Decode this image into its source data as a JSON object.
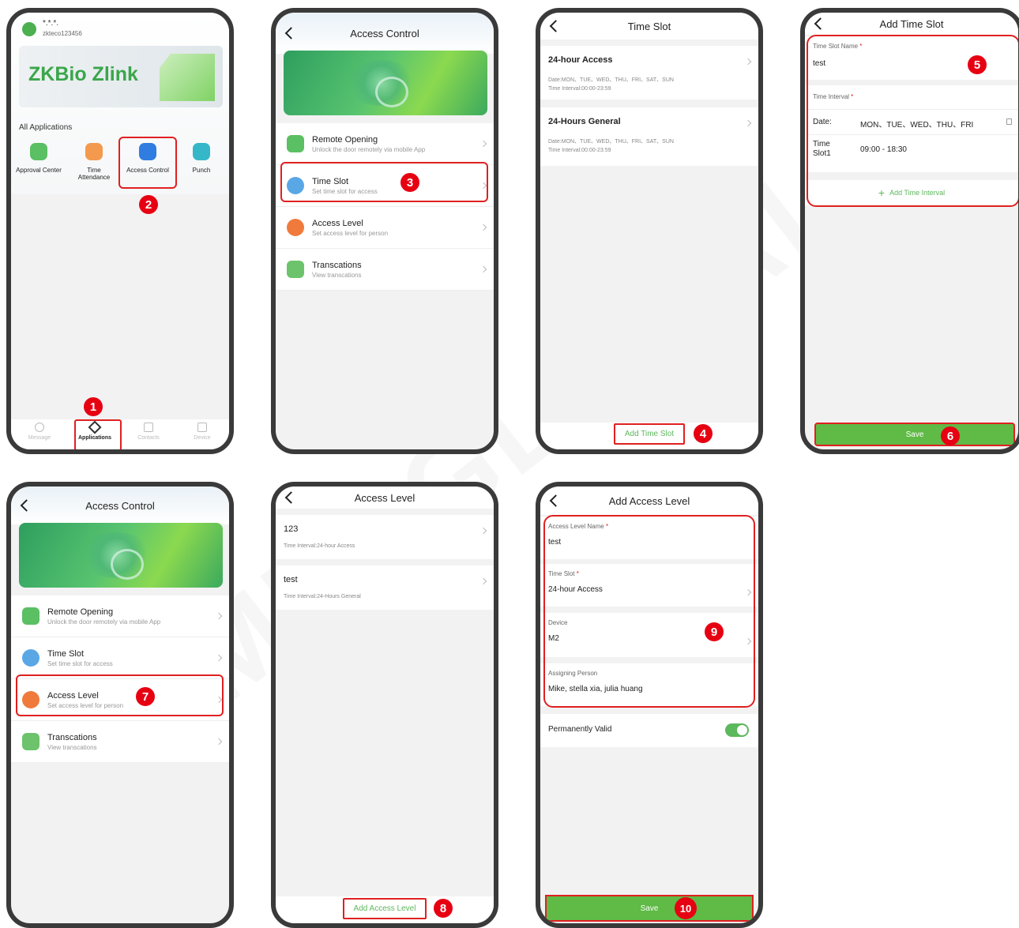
{
  "colors": {
    "accent": "#5fba46",
    "badge": "#e60012",
    "highlight": "#e02020"
  },
  "steps": [
    "1",
    "2",
    "3",
    "4",
    "5",
    "6",
    "7",
    "8",
    "9",
    "10"
  ],
  "watermark": "TEMID-GLOBAL",
  "s1": {
    "masked_name": "*.*.*.",
    "username": "zkteco123456",
    "banner_text": "ZKBio Zlink",
    "section": "All Applications",
    "apps": [
      {
        "label": "Approval Center",
        "icon": "approval-icon"
      },
      {
        "label": "Time Attendance",
        "icon": "time-attendance-icon"
      },
      {
        "label": "Access Control",
        "icon": "access-control-icon"
      },
      {
        "label": "Punch",
        "icon": "punch-icon"
      }
    ],
    "tabs": [
      {
        "label": "Message",
        "icon": "message-icon"
      },
      {
        "label": "Applications",
        "icon": "applications-icon"
      },
      {
        "label": "Contacts",
        "icon": "contacts-icon"
      },
      {
        "label": "Device",
        "icon": "device-icon"
      }
    ]
  },
  "ac": {
    "title": "Access Control",
    "items": [
      {
        "title": "Remote Opening",
        "sub": "Unlock the door remotely via mobile App"
      },
      {
        "title": "Time Slot",
        "sub": "Set time slot for access"
      },
      {
        "title": "Access Level",
        "sub": "Set access level for person"
      },
      {
        "title": "Transcations",
        "sub": "View transcations"
      }
    ]
  },
  "ts": {
    "title": "Time Slot",
    "items": [
      {
        "name": "24-hour Access",
        "date": "Date:MON、TUE、WED、THU、FRI、SAT、SUN",
        "interval": "Time Interval:00:00-23:59"
      },
      {
        "name": "24-Hours General",
        "date": "Date:MON、TUE、WED、THU、FRI、SAT、SUN",
        "interval": "Time Interval:00:00-23:59"
      }
    ],
    "add_button": "Add Time Slot"
  },
  "ats": {
    "title": "Add Time Slot",
    "name_label": "Time Slot Name",
    "name_value": "test",
    "interval_label": "Time Interval",
    "date_label": "Date:",
    "date_value": "MON、TUE、WED、THU、FRI",
    "slot_label_1": "Time",
    "slot_label_2": "Slot1",
    "slot_value": "09:00 - 18:30",
    "add_interval": "Add Time Interval",
    "save": "Save"
  },
  "al": {
    "title": "Access Level",
    "items": [
      {
        "name": "123",
        "interval": "Time Interval:24-hour Access"
      },
      {
        "name": "test",
        "interval": "Time Interval:24-Hours General"
      }
    ],
    "add_button": "Add Access Level"
  },
  "aal": {
    "title": "Add Access Level",
    "name_label": "Access Level Name",
    "name_value": "test",
    "slot_label": "Time Slot",
    "slot_value": "24-hour Access",
    "device_label": "Device",
    "device_value": "M2",
    "person_label": "Assigning Person",
    "person_value": "Mike, stella xia, julia  huang",
    "valid_label": "Permanently Valid",
    "valid_on": true,
    "save": "Save"
  }
}
